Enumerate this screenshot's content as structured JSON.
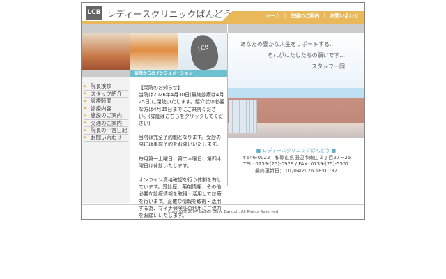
{
  "header": {
    "logo_text": "LCB",
    "site_title": "レディースクリニックばんどう",
    "nav": [
      "ホーム",
      "交通のご案内",
      "お問い合わせ"
    ]
  },
  "photo_logo": "LCB",
  "tagline": {
    "line1": "あなたの豊かな人生をサポートする...",
    "line2": "それがわたしたちの願いです...",
    "line3": "スタッフ一同"
  },
  "menu": [
    "院長挨拶",
    "スタッフ紹介",
    "診療時間",
    "診療内容",
    "施設のご案内",
    "交通のご案内",
    "院長の一言日記",
    "お問い合わせ"
  ],
  "info": {
    "heading": "当院からのインフォメーション",
    "paragraphs": [
      "【閉院のお知らせ】\n当院は2026年4月30日(最終診療は4月25日)に閉院いたします。紹介状の必要な方は4月25日までにご来院ください。(詳細はこちらをクリックしてください)",
      "当院は完全予約制となります。受診の際には事前予約をお願いいたします。",
      "毎月第一土曜日、第二木曜日、第四木曜日は休診いたします。",
      "オンライン資格確認を行う体制を有しています。受診歴、薬剤情報、その他必要な診療情報を取得・活用して診療を行います。正確な情報を取得・活用する為、マイナ保険証の利用にご協力をお願いいたします。"
    ]
  },
  "address": {
    "name": "■ レディースクリニックばんどう ■",
    "postal": "〒646-0022　和歌山県田辺市東山２丁目27－26",
    "tel": "TEL: 0739-(25)-0929 / FAX: 0739-(25)-5557",
    "updated": "最終更新日： 01/04/2026 18:01:32"
  },
  "footer": {
    "copyright": "Copyright 2004 Ladies Clinic Bandoh. All Rights Reserved"
  },
  "colors": {
    "gold": "#e8b85a",
    "teal": "#6cc0d0"
  }
}
